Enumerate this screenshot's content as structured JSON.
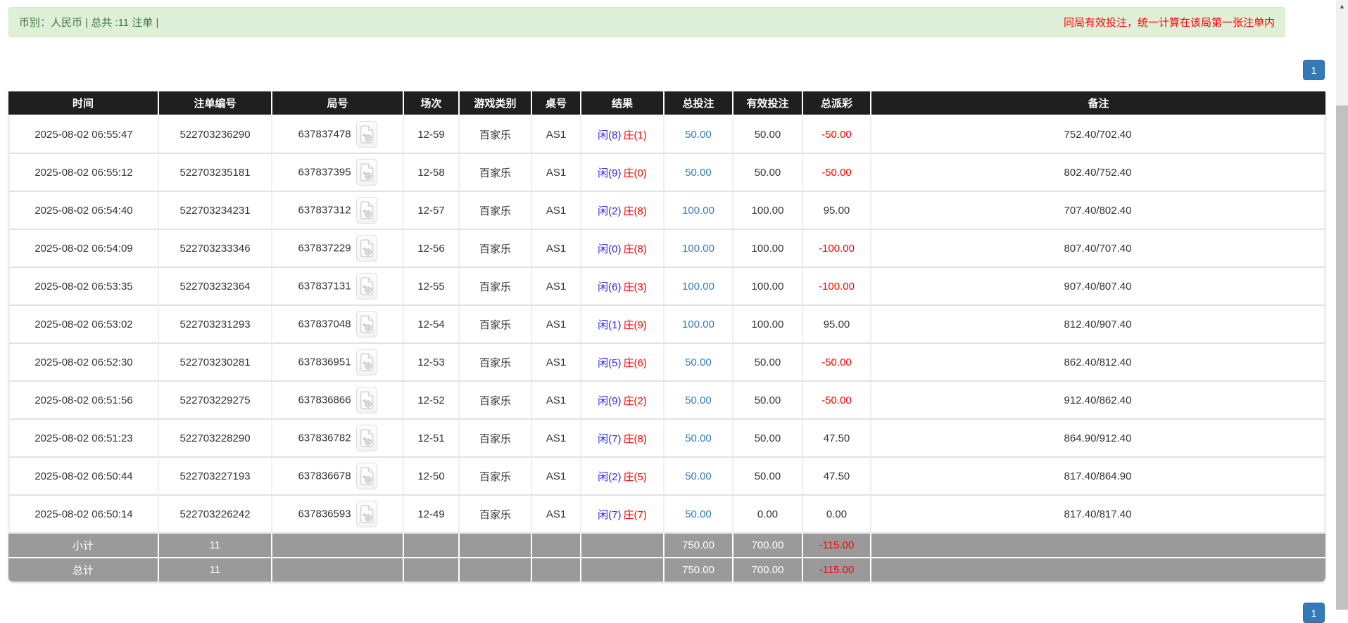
{
  "banner": {
    "left_text": "币别：人民币 | 总共 :11 注单 |",
    "right_notice": "同局有效投注，统一计算在该局第一张注单内"
  },
  "pagination": {
    "top_page": "1",
    "bottom_page": "1"
  },
  "icons": {
    "round_video": "video-file-icon",
    "scroll_up_glyph": "▲"
  },
  "colors": {
    "banner_bg": "#dff0d8",
    "banner_text": "#3c763d",
    "notice_red": "#ff0000",
    "header_bg": "#1f1f1f",
    "link_blue": "#337ab7",
    "player_blue": "#2929ee",
    "banker_red": "#ff0000",
    "negative_red": "#ff0000",
    "total_row_bg": "#9a9a9a",
    "page_button_bg": "#337ab7",
    "scroll_thumb": "#c1c1c1"
  },
  "table": {
    "headers": [
      "时间",
      "注单编号",
      "局号",
      "场次",
      "游戏类别",
      "桌号",
      "结果",
      "总投注",
      "有效投注",
      "总派彩",
      "备注"
    ],
    "rows": [
      {
        "time": "2025-08-02 06:55:47",
        "bet_id": "522703236290",
        "round_id": "637837478",
        "session": "12-59",
        "game": "百家乐",
        "table_no": "AS1",
        "result_player": "闲(8)",
        "result_banker": "庄(1)",
        "total_bet": "50.00",
        "valid_bet": "50.00",
        "payout": "-50.00",
        "remark": "752.40/702.40"
      },
      {
        "time": "2025-08-02 06:55:12",
        "bet_id": "522703235181",
        "round_id": "637837395",
        "session": "12-58",
        "game": "百家乐",
        "table_no": "AS1",
        "result_player": "闲(9)",
        "result_banker": "庄(0)",
        "total_bet": "50.00",
        "valid_bet": "50.00",
        "payout": "-50.00",
        "remark": "802.40/752.40"
      },
      {
        "time": "2025-08-02 06:54:40",
        "bet_id": "522703234231",
        "round_id": "637837312",
        "session": "12-57",
        "game": "百家乐",
        "table_no": "AS1",
        "result_player": "闲(2)",
        "result_banker": "庄(8)",
        "total_bet": "100.00",
        "valid_bet": "100.00",
        "payout": "95.00",
        "remark": "707.40/802.40"
      },
      {
        "time": "2025-08-02 06:54:09",
        "bet_id": "522703233346",
        "round_id": "637837229",
        "session": "12-56",
        "game": "百家乐",
        "table_no": "AS1",
        "result_player": "闲(0)",
        "result_banker": "庄(8)",
        "total_bet": "100.00",
        "valid_bet": "100.00",
        "payout": "-100.00",
        "remark": "807.40/707.40"
      },
      {
        "time": "2025-08-02 06:53:35",
        "bet_id": "522703232364",
        "round_id": "637837131",
        "session": "12-55",
        "game": "百家乐",
        "table_no": "AS1",
        "result_player": "闲(6)",
        "result_banker": "庄(3)",
        "total_bet": "100.00",
        "valid_bet": "100.00",
        "payout": "-100.00",
        "remark": "907.40/807.40"
      },
      {
        "time": "2025-08-02 06:53:02",
        "bet_id": "522703231293",
        "round_id": "637837048",
        "session": "12-54",
        "game": "百家乐",
        "table_no": "AS1",
        "result_player": "闲(1)",
        "result_banker": "庄(9)",
        "total_bet": "100.00",
        "valid_bet": "100.00",
        "payout": "95.00",
        "remark": "812.40/907.40"
      },
      {
        "time": "2025-08-02 06:52:30",
        "bet_id": "522703230281",
        "round_id": "637836951",
        "session": "12-53",
        "game": "百家乐",
        "table_no": "AS1",
        "result_player": "闲(5)",
        "result_banker": "庄(6)",
        "total_bet": "50.00",
        "valid_bet": "50.00",
        "payout": "-50.00",
        "remark": "862.40/812.40"
      },
      {
        "time": "2025-08-02 06:51:56",
        "bet_id": "522703229275",
        "round_id": "637836866",
        "session": "12-52",
        "game": "百家乐",
        "table_no": "AS1",
        "result_player": "闲(9)",
        "result_banker": "庄(2)",
        "total_bet": "50.00",
        "valid_bet": "50.00",
        "payout": "-50.00",
        "remark": "912.40/862.40"
      },
      {
        "time": "2025-08-02 06:51:23",
        "bet_id": "522703228290",
        "round_id": "637836782",
        "session": "12-51",
        "game": "百家乐",
        "table_no": "AS1",
        "result_player": "闲(7)",
        "result_banker": "庄(8)",
        "total_bet": "50.00",
        "valid_bet": "50.00",
        "payout": "47.50",
        "remark": "864.90/912.40"
      },
      {
        "time": "2025-08-02 06:50:44",
        "bet_id": "522703227193",
        "round_id": "637836678",
        "session": "12-50",
        "game": "百家乐",
        "table_no": "AS1",
        "result_player": "闲(2)",
        "result_banker": "庄(5)",
        "total_bet": "50.00",
        "valid_bet": "50.00",
        "payout": "47.50",
        "remark": "817.40/864.90"
      },
      {
        "time": "2025-08-02 06:50:14",
        "bet_id": "522703226242",
        "round_id": "637836593",
        "session": "12-49",
        "game": "百家乐",
        "table_no": "AS1",
        "result_player": "闲(7)",
        "result_banker": "庄(7)",
        "total_bet": "50.00",
        "valid_bet": "0.00",
        "payout": "0.00",
        "remark": "817.40/817.40"
      }
    ],
    "subtotal": {
      "label": "小计",
      "count": "11",
      "total_bet": "750.00",
      "valid_bet": "700.00",
      "payout": "-115.00"
    },
    "grand_total": {
      "label": "总计",
      "count": "11",
      "total_bet": "750.00",
      "valid_bet": "700.00",
      "payout": "-115.00"
    }
  }
}
